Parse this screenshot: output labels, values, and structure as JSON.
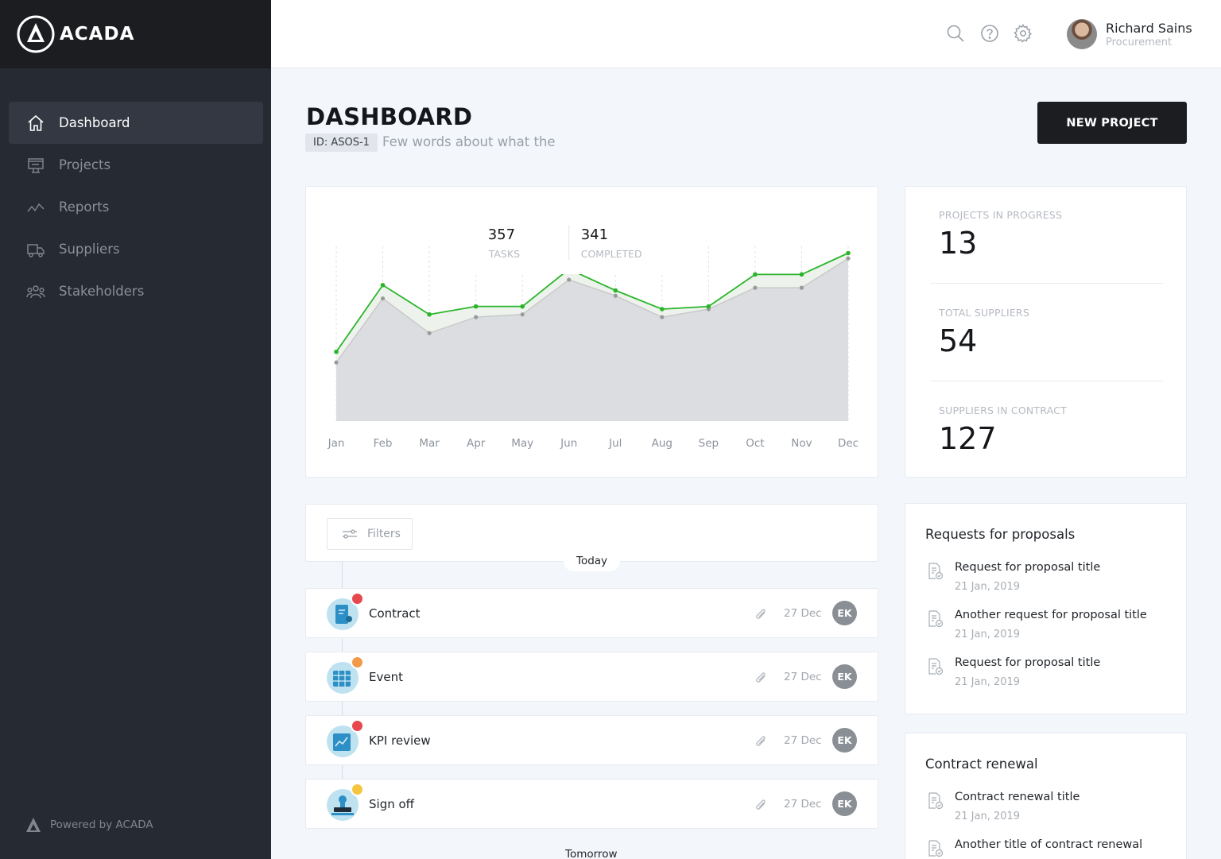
{
  "brand": {
    "name": "ACADA"
  },
  "sidebar": {
    "items": [
      {
        "label": "Dashboard",
        "icon": "home-icon",
        "active": true
      },
      {
        "label": "Projects",
        "icon": "projects-icon",
        "active": false
      },
      {
        "label": "Reports",
        "icon": "reports-icon",
        "active": false
      },
      {
        "label": "Suppliers",
        "icon": "truck-icon",
        "active": false
      },
      {
        "label": "Stakeholders",
        "icon": "people-icon",
        "active": false
      }
    ],
    "powered_by": "Powered by ACADA"
  },
  "topbar": {
    "icons": [
      "search-icon",
      "help-icon",
      "gear-icon"
    ],
    "user": {
      "name": "Richard Sains",
      "role": "Procurement"
    }
  },
  "header": {
    "title": "DASHBOARD",
    "id_badge": "ID: ASOS-1",
    "subtitle": "Few words about what the",
    "new_project_label": "NEW PROJECT"
  },
  "chart_data": {
    "type": "area",
    "categories": [
      "Jan",
      "Feb",
      "Mar",
      "Apr",
      "May",
      "Jun",
      "Jul",
      "Aug",
      "Sep",
      "Oct",
      "Nov",
      "Dec"
    ],
    "series": [
      {
        "name": "TASKS",
        "values": [
          22,
          46,
          33,
          39,
          40,
          53,
          47,
          39,
          42,
          50,
          50,
          61
        ],
        "color": "#c9c9c9"
      },
      {
        "name": "COMPLETED",
        "values": [
          26,
          51,
          40,
          43,
          43,
          57,
          49,
          42,
          43,
          55,
          55,
          63
        ],
        "color": "#2ab52a"
      }
    ],
    "ylim": [
      0,
      70
    ],
    "grid": "vertical-dashed",
    "tooltip": {
      "tasks_value": "357",
      "tasks_label": "TASKS",
      "completed_value": "341",
      "completed_label": "COMPLETED",
      "month": "Jun"
    }
  },
  "stats": [
    {
      "label": "PROJECTS IN PROGRESS",
      "value": "13"
    },
    {
      "label": "TOTAL SUPPLIERS",
      "value": "54"
    },
    {
      "label": "SUPPLIERS IN CONTRACT",
      "value": "127"
    }
  ],
  "timeline": {
    "filters_label": "Filters",
    "today_label": "Today",
    "tomorrow_label": "Tomorrow",
    "tasks": [
      {
        "title": "Contract",
        "date": "27 Dec",
        "assignee": "EK",
        "icon": "contract-icon",
        "flag_color": "#e5484d"
      },
      {
        "title": "Event",
        "date": "27 Dec",
        "assignee": "EK",
        "icon": "calendar-icon",
        "flag_color": "#f2994a"
      },
      {
        "title": "KPI review",
        "date": "27 Dec",
        "assignee": "EK",
        "icon": "kpi-icon",
        "flag_color": "#e5484d"
      },
      {
        "title": "Sign off",
        "date": "27 Dec",
        "assignee": "EK",
        "icon": "stamp-icon",
        "flag_color": "#f5c542"
      }
    ]
  },
  "rfp": {
    "title": "Requests for proposals",
    "items": [
      {
        "title": "Request for proposal title",
        "date": "21 Jan, 2019"
      },
      {
        "title": "Another request for proposal title",
        "date": "21 Jan, 2019"
      },
      {
        "title": "Request for proposal title",
        "date": "21 Jan, 2019"
      }
    ]
  },
  "contract_renewal": {
    "title": "Contract renewal",
    "items": [
      {
        "title": "Contract renewal title",
        "date": "21 Jan, 2019"
      },
      {
        "title": "Another title of contract renewal",
        "date": ""
      }
    ]
  }
}
